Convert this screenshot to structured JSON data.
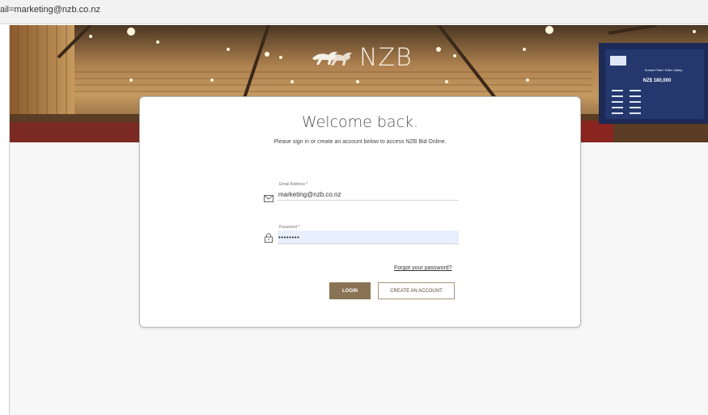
{
  "address_bar": {
    "text": "ail=marketing@nzb.co.nz"
  },
  "brand": {
    "logo_text": "NZB"
  },
  "hero": {
    "screen_title": "Sunset Falls / Eden Valley",
    "screen_price": "NZ$ 180,000"
  },
  "login_card": {
    "title": "Welcome back.",
    "subtitle": "Please sign in or create an account below to access NZB Bid Online.",
    "email": {
      "label": "Email Address *",
      "value": "marketing@nzb.co.nz"
    },
    "password": {
      "label": "Password *",
      "value": "password"
    },
    "forgot_link": "Forgot your password?",
    "login_button": "LOGIN",
    "create_button": "CREATE AN ACCOUNT"
  },
  "colors": {
    "accent": "#8a7355",
    "autofill": "#e8f0fe",
    "hero_wood": "#9a6a35"
  },
  "icons": [
    "mail-icon",
    "lock-icon",
    "horses-logo-icon"
  ]
}
